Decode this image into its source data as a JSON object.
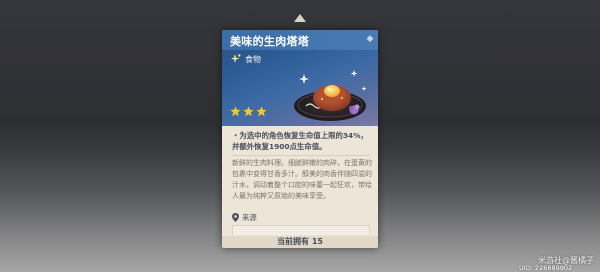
{
  "item": {
    "title": "美味的生肉塔塔",
    "category": "食物",
    "rarity_stars": 3,
    "effect": "・为选中的角色恢复生命值上限的34%，并额外恢复1900点生命值。",
    "description": "新鲜的生肉料理。细腻鲜嫩的肉碎，在蛋黄的包裹中变得甘香多汁。醇美的肉香伴随四溢的汁水，调动着整个口腔的味蕾一起狂欢，带给人最为纯粹又原始的美味享受。",
    "source_label": "来源",
    "owned": "当前拥有 15"
  },
  "icons": {
    "category": "food-sparkle-icon",
    "star": "star-icon",
    "source": "map-pin-icon",
    "close": "close-icon"
  },
  "overlay": {
    "watermark": "米游社@酱橘子",
    "uid": "UID: 226889902"
  },
  "colors": {
    "header_blue": "#2d5b95",
    "card_bg": "#ece5d8",
    "star": "#f5c531",
    "text_dark": "#4a4f5c",
    "text_muted": "#7b7567"
  }
}
